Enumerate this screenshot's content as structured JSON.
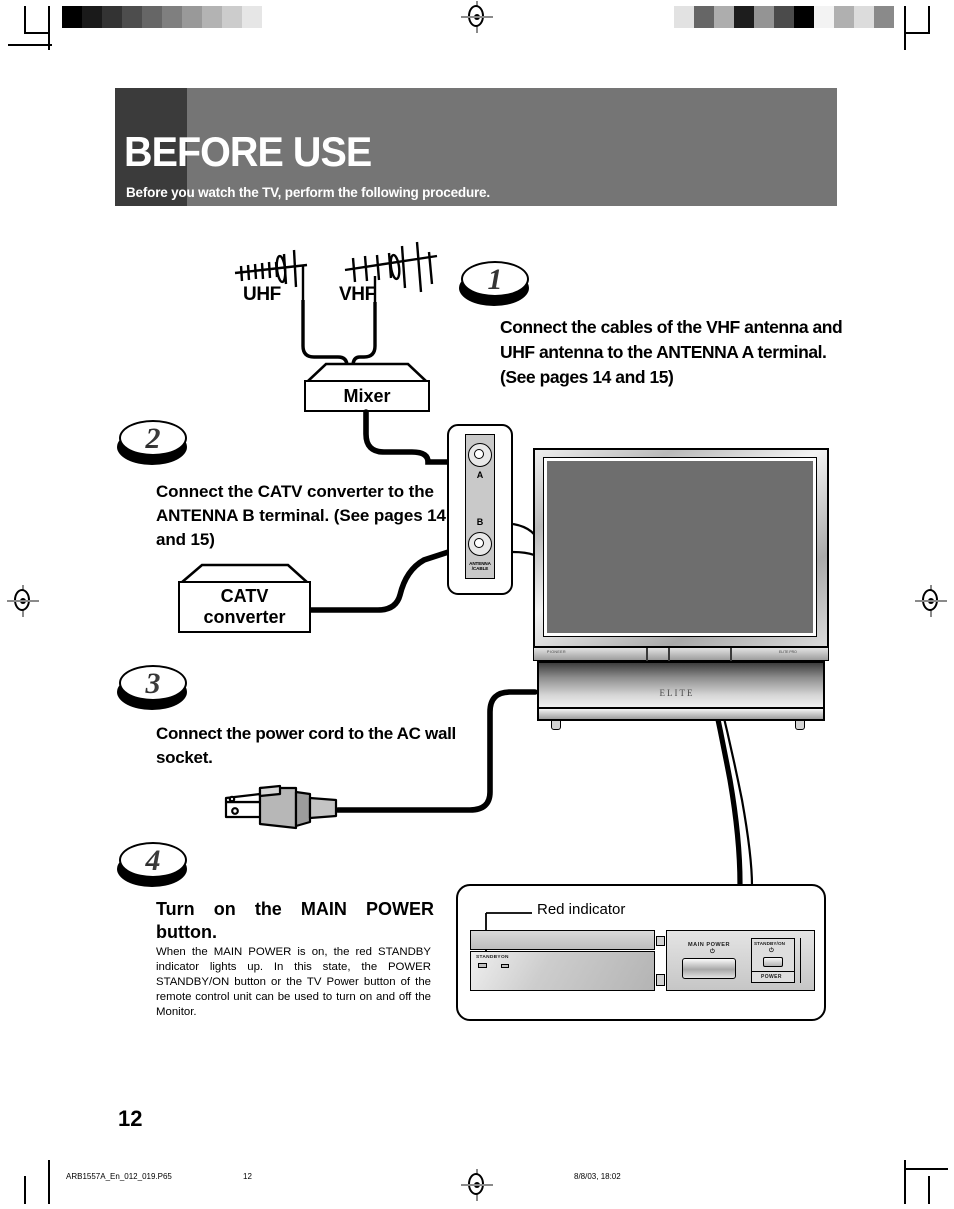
{
  "header": {
    "title": "BEFORE USE",
    "subtitle": "Before you watch the TV, perform the following procedure.",
    "band_color": "#757575",
    "dark_block_color": "#3b3b3b",
    "text_color": "#ffffff"
  },
  "steps": [
    {
      "number": "1",
      "text": "Connect the cables of the VHF antenna and UHF antenna to the ANTENNA A terminal. (See pages 14 and 15)"
    },
    {
      "number": "2",
      "text": "Connect the CATV converter to the ANTENNA B terminal. (See pages 14 and 15)"
    },
    {
      "number": "3",
      "text": "Connect the power cord to the AC wall socket."
    },
    {
      "number": "4",
      "text": "Turn on the MAIN POWER button.",
      "body": "When the MAIN POWER is on, the red STANDBY indicator lights up. In this state, the POWER STANDBY/ON button or the TV Power button of the remote control unit can be used to turn on and off the Monitor."
    }
  ],
  "diagram": {
    "uhf_label": "UHF",
    "vhf_label": "VHF",
    "mixer_label": "Mixer",
    "catv_label_line1": "CATV",
    "catv_label_line2": "converter",
    "terminal_a": "A",
    "terminal_b": "B",
    "terminal_caption_line1": "ANTENNA",
    "terminal_caption_line2": "/CABLE",
    "tv_brand": "ELITE",
    "tv_brand_small": "PIONEER",
    "tv_model_small": "ELITE PRO"
  },
  "callout": {
    "red_indicator_label": "Red indicator",
    "standby_label": "STANDBY",
    "on_label": "ON",
    "main_power_label": "MAIN POWER",
    "main_power_symbol": "⏻",
    "standby_on_label": "STANDBY/ON",
    "standby_on_symbol": "⏻",
    "power_label": "POWER"
  },
  "footer": {
    "page_number": "12",
    "file_name": "ARB1557A_En_012_019.P65",
    "footer_page": "12",
    "date_stamp": "8/8/03, 18:02"
  },
  "print_marks": {
    "left_bar_steps": [
      "#000000",
      "#1a1a1a",
      "#333333",
      "#4d4d4d",
      "#666666",
      "#7f7f7f",
      "#999999",
      "#b3b3b3",
      "#cccccc",
      "#e6e6e6",
      "#ffffff"
    ],
    "right_bar_steps": [
      "#e2e2e2",
      "#666666",
      "#adadad",
      "#1d1d1d",
      "#949494",
      "#4b4b4b",
      "#000000",
      "#f3f3f3",
      "#b0b0b0",
      "#dcdcdc",
      "#8a8a8a"
    ]
  }
}
